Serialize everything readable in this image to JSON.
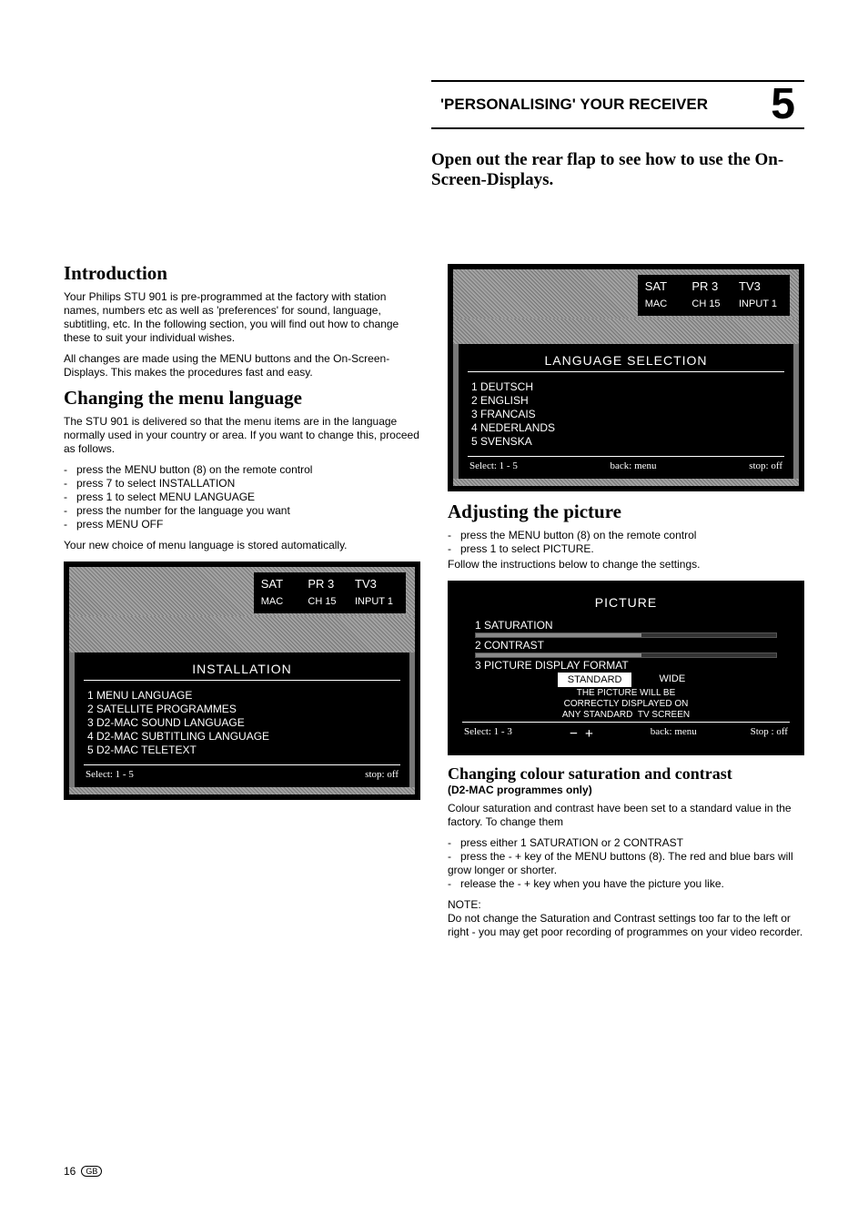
{
  "header": {
    "title": "'PERSONALISING' YOUR RECEIVER",
    "chapter": "5"
  },
  "intro_line": "Open out the rear flap to see how to use the On-Screen-Displays.",
  "left": {
    "h_intro": "Introduction",
    "p1": "Your Philips STU 901 is pre-programmed at the factory with station names, numbers etc as well as 'preferences' for sound, language, subtitling, etc. In the following section, you will find out how to change these to suit your individual wishes.",
    "p2": "All changes are made using the MENU buttons and the On-Screen-Displays. This makes the procedures fast and easy.",
    "h_lang": "Changing the menu language",
    "p3": "The STU 901 is delivered so that the menu items are in the language normally used in your country or area. If you want to change this, proceed as follows.",
    "steps_lang": [
      "press the MENU button (8) on the remote control",
      "press 7 to select INSTALLATION",
      "press 1 to select MENU LANGUAGE",
      "press the number for the language you want",
      "press MENU OFF"
    ],
    "p4": "Your new choice of menu language is stored automatically.",
    "osd_install": {
      "status_top": [
        "SAT",
        "PR 3",
        "TV3"
      ],
      "status_bot": [
        "MAC",
        "CH 15",
        "INPUT 1"
      ],
      "title": "INSTALLATION",
      "items": [
        "1  MENU LANGUAGE",
        "2  SATELLITE PROGRAMMES",
        "3  D2-MAC SOUND LANGUAGE",
        "4  D2-MAC SUBTITLING LANGUAGE",
        "5  D2-MAC TELETEXT"
      ],
      "foot_l": "Select: 1 - 5",
      "foot_r": "stop:  off"
    }
  },
  "right": {
    "osd_lang": {
      "status_top": [
        "SAT",
        "PR 3",
        "TV3"
      ],
      "status_bot": [
        "MAC",
        "CH 15",
        "INPUT 1"
      ],
      "title": "LANGUAGE SELECTION",
      "items": [
        "1  DEUTSCH",
        "2  ENGLISH",
        "3  FRANCAIS",
        "4  NEDERLANDS",
        "5  SVENSKA"
      ],
      "foot_l": "Select: 1 - 5",
      "foot_m": "back: menu",
      "foot_r": "stop:  off"
    },
    "h_adj": "Adjusting the picture",
    "steps_adj": [
      "press the MENU button (8) on the remote control",
      "press 1 to select PICTURE."
    ],
    "p_adj": "Follow the instructions below to change the settings.",
    "osd_pic": {
      "title": "PICTURE",
      "i1": "1  SATURATION",
      "i2": "2  CONTRAST",
      "i3": "3  PICTURE DISPLAY FORMAT",
      "btn1": "STANDARD",
      "btn2": "WIDE",
      "desc": "THE PICTURE WILL BE\nCORRECTLY DISPLAYED ON\nANY STANDARD  TV SCREEN",
      "foot_l": "Select: 1 - 3",
      "foot_m": "back: menu",
      "foot_r": "Stop : off"
    },
    "h_sat": "Changing colour saturation and contrast",
    "sub_sat": "(D2-MAC programmes only)",
    "p_sat": "Colour saturation and contrast have been set to a standard value in the factory. To change them",
    "steps_sat": [
      "press either 1 SATURATION or 2 CONTRAST",
      "press the - + key of the MENU buttons (8). The red and blue bars will grow longer or shorter.",
      "release the - + key when you have the picture you like."
    ],
    "note_h": "NOTE:",
    "note": "Do not change the Saturation and Contrast settings too far to the left or right -  you may get  poor recording of programmes on your video recorder."
  },
  "page": {
    "num": "16",
    "reg": "GB"
  }
}
